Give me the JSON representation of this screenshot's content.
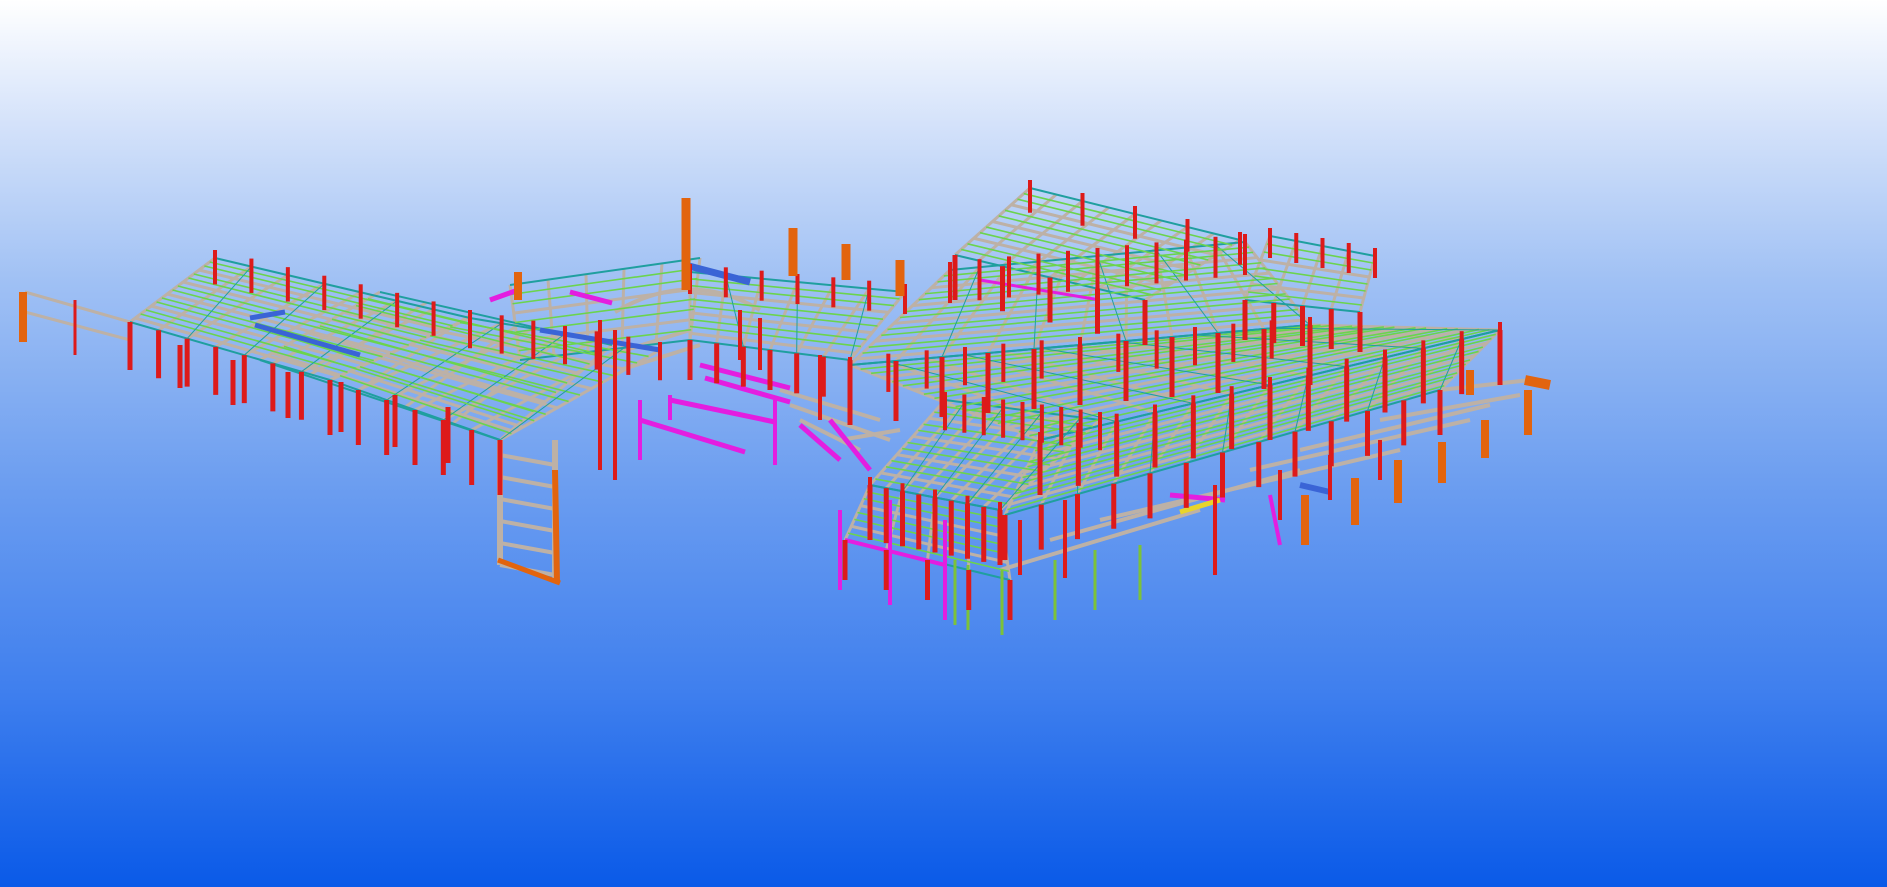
{
  "viewport": {
    "background_top": "#ffffff",
    "background_bottom": "#0a5ae8"
  },
  "model": {
    "description_icon": "steel-structure-3d-model",
    "colors": {
      "columns": "#dd1a1a",
      "primary_beams": "#bdb1a6",
      "secondary_members": "#6bd44d",
      "roof_edge": "#1f9f9f",
      "bracing": "#e31ee0",
      "heavy_columns": "#e2640e",
      "channel_members": "#3a64d6",
      "pipes": "#7cc23a"
    }
  }
}
